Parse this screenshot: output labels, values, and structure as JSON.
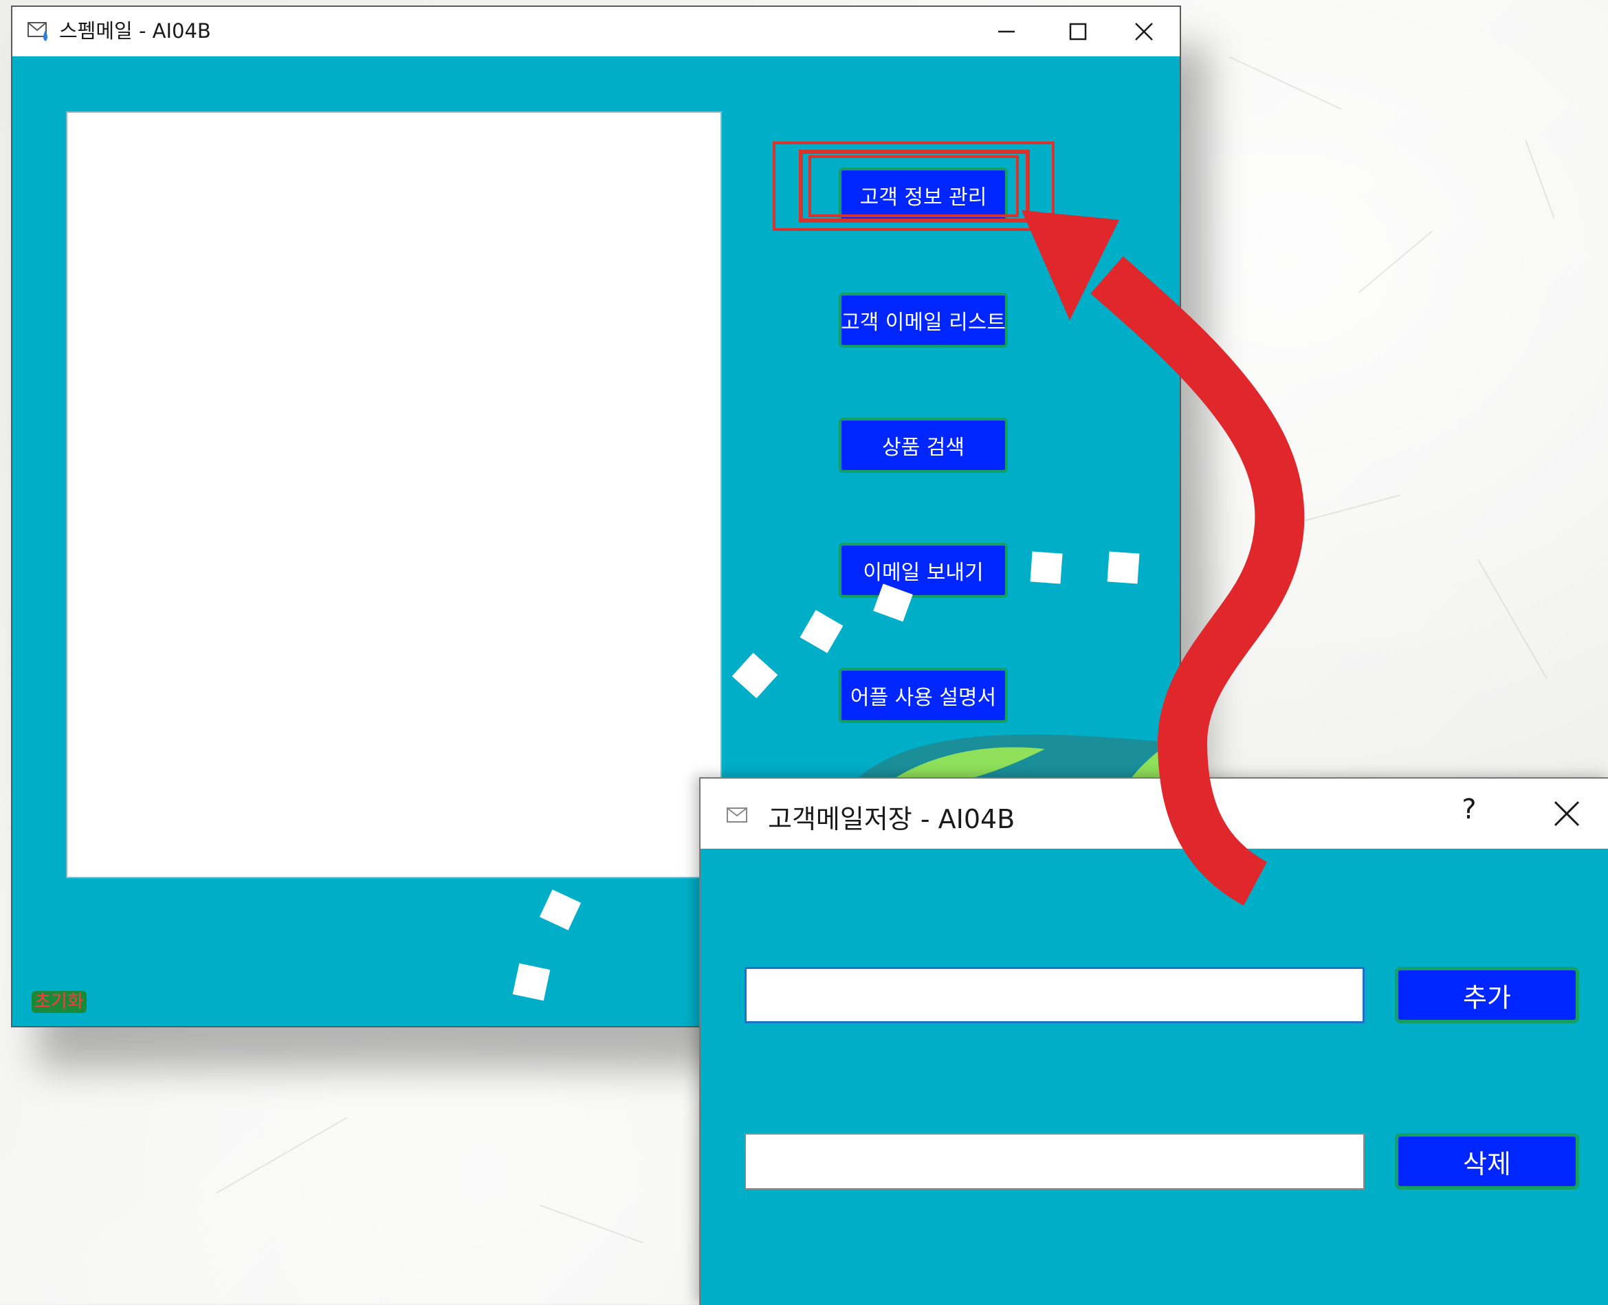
{
  "main_window": {
    "title": "스펨메일 - AI04B",
    "menu": {
      "customer_info": "고객 정보 관리",
      "email_list": "고객 이메일 리스트",
      "product_search": "상품 검색",
      "send_email": "이메일 보내기",
      "manual": "어플 사용 설명서"
    },
    "reset_label": "초기화"
  },
  "dialog": {
    "title": "고객메일저장 - AI04B",
    "help_label": "?",
    "add_input_value": "",
    "delete_input_value": "",
    "add_button": "추가",
    "delete_button": "삭제"
  },
  "colors": {
    "window_bg": "#00aec8",
    "button_bg": "#0026ff",
    "button_border": "#14a064",
    "annotation_red": "#e0272b"
  }
}
